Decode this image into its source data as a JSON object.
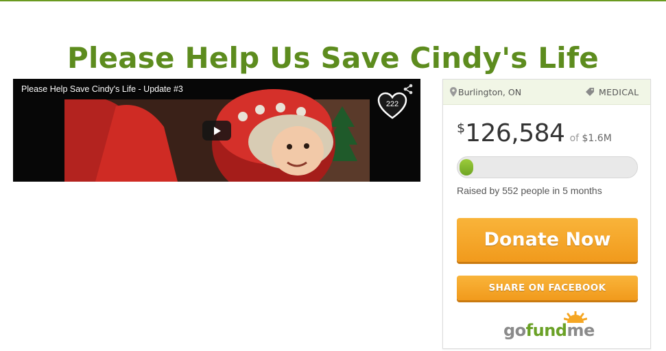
{
  "page": {
    "title": "Please Help Us Save Cindy's Life",
    "accent_color": "#5d8c1e"
  },
  "video": {
    "caption": "Please Help Save Cindy's Life - Update #3",
    "likes": "222",
    "icons": [
      "share-icon",
      "heart-icon",
      "play-icon"
    ]
  },
  "campaign": {
    "location": "Burlington, ON",
    "category": "MEDICAL",
    "currency_symbol": "$",
    "raised": "126,584",
    "of_label": "of",
    "goal": "$1.6M",
    "progress_fraction": 0.079,
    "raised_by_text": "Raised by 552 people in 5 months",
    "donate_label": "Donate Now",
    "share_label": "SHARE ON FACEBOOK",
    "logo": {
      "part1": "go",
      "part2": "fund",
      "part3": "me"
    },
    "button_color": "#f4a52a",
    "progress_color": "#7db32e"
  }
}
